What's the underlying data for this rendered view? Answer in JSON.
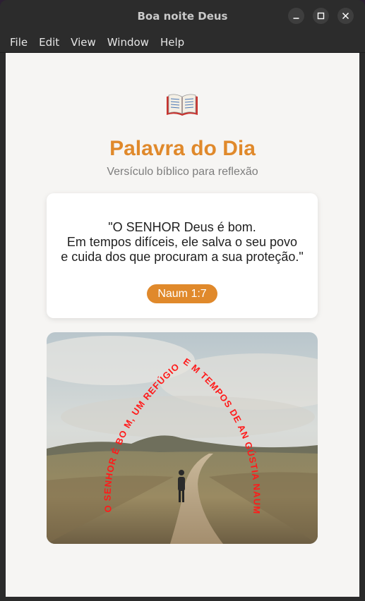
{
  "window": {
    "title": "Boa noite Deus",
    "controls": [
      "minimize-icon",
      "maximize-icon",
      "close-icon"
    ]
  },
  "menu": [
    "File",
    "Edit",
    "View",
    "Window",
    "Help"
  ],
  "header": {
    "icon": "open-book-icon",
    "title": "Palavra do Dia",
    "subtitle": "Versículo bíblico para reflexão"
  },
  "verse": {
    "lines": [
      "\"O SENHOR Deus é bom.",
      "Em tempos difíceis, ele salva o seu povo",
      "e cuida dos que procuram a sua proteção.\""
    ],
    "reference": "Naum 1:7"
  },
  "image": {
    "overlay_text": "O SENHOR É BO M, UM REFÚGIO E M TEMPOS DE AN GÚSTIA  NAUM",
    "overlay_color": "#ff1a1a"
  },
  "colors": {
    "accent": "#e0892b",
    "background": "#f6f5f3"
  }
}
